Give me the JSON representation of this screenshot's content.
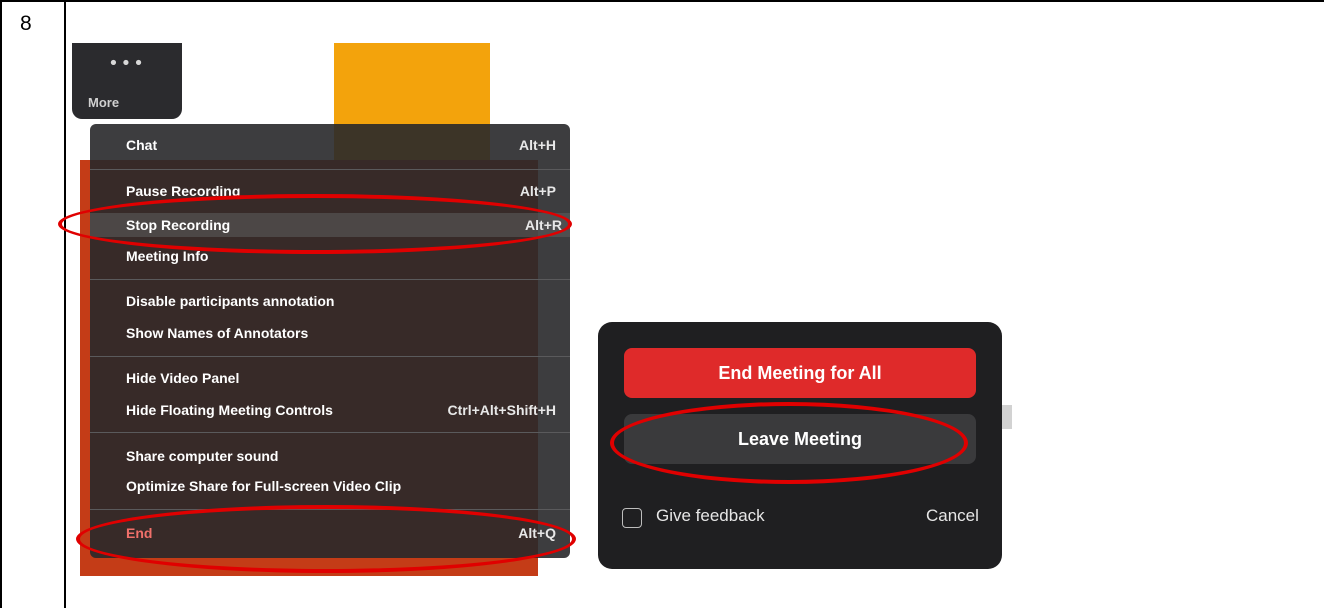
{
  "document": {
    "step_number": "8"
  },
  "toolbar": {
    "more_dots": "•••",
    "more_label": "More"
  },
  "menu": {
    "items": [
      {
        "label": "Chat",
        "shortcut": "Alt+H"
      },
      {
        "label": "Pause Recording",
        "shortcut": "Alt+P"
      },
      {
        "label": "Stop Recording",
        "shortcut": "Alt+R"
      },
      {
        "label": "Meeting Info",
        "shortcut": ""
      },
      {
        "label": "Disable participants annotation",
        "shortcut": ""
      },
      {
        "label": "Show Names of Annotators",
        "shortcut": ""
      },
      {
        "label": "Hide Video Panel",
        "shortcut": ""
      },
      {
        "label": "Hide Floating Meeting Controls",
        "shortcut": "Ctrl+Alt+Shift+H"
      },
      {
        "label": "Share computer sound",
        "shortcut": ""
      },
      {
        "label": "Optimize Share for Full-screen Video Clip",
        "shortcut": ""
      },
      {
        "label": "End",
        "shortcut": "Alt+Q"
      }
    ]
  },
  "dialog": {
    "end_all_label": "End Meeting for All",
    "leave_label": "Leave Meeting",
    "feedback_label": "Give feedback",
    "cancel_label": "Cancel"
  },
  "colors": {
    "annotation_ellipse": "#e00000",
    "end_meeting_button": "#df2a2a",
    "orange_tile": "#f3a30c",
    "share_background": "#c43c17"
  }
}
